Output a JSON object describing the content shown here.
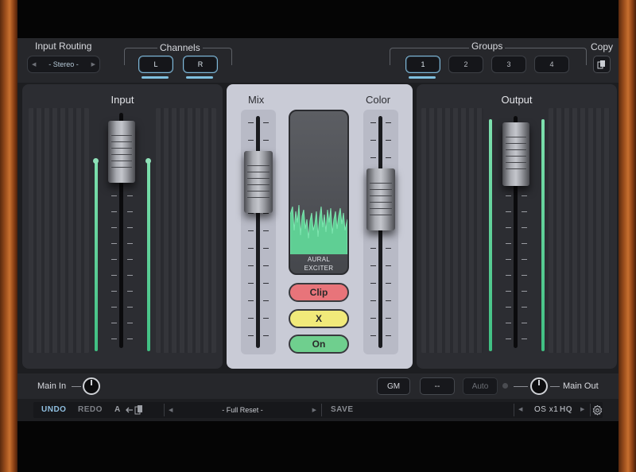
{
  "header": {
    "input_routing_label": "Input Routing",
    "input_routing_value": "- Stereo -",
    "channels_label": "Channels",
    "channels": [
      "L",
      "R"
    ],
    "groups_label": "Groups",
    "groups": [
      "1",
      "2",
      "3",
      "4"
    ],
    "copy_label": "Copy"
  },
  "panels": {
    "input_title": "Input",
    "mix_title": "Mix",
    "color_title": "Color",
    "output_title": "Output",
    "display_label_line1": "AURAL",
    "display_label_line2": "EXCITER",
    "mode_buttons": [
      "Clip",
      "X",
      "On"
    ],
    "mode_colors": {
      "clip": "#e8747a",
      "x": "#f1ea7a",
      "on": "#6fcf8e"
    }
  },
  "footer": {
    "main_in_label": "Main In",
    "gm_label": "GM",
    "dash_label": "--",
    "auto_label": "Auto",
    "main_out_label": "Main Out"
  },
  "toolbar": {
    "undo": "UNDO",
    "redo": "REDO",
    "ab": "A",
    "preset_name": "- Full Reset -",
    "save": "SAVE",
    "os_label": "OS x1",
    "hq_label": "HQ"
  },
  "colors": {
    "meter_green": "#5fd49a",
    "active_blue": "#7fc0df",
    "wood": "#9a4d1c"
  },
  "icons": {
    "copy": "copy-icon",
    "ab_copy": "ab-copy-icon",
    "settings": "gear-icon",
    "prev": "triangle-left-icon",
    "next": "triangle-right-icon"
  }
}
